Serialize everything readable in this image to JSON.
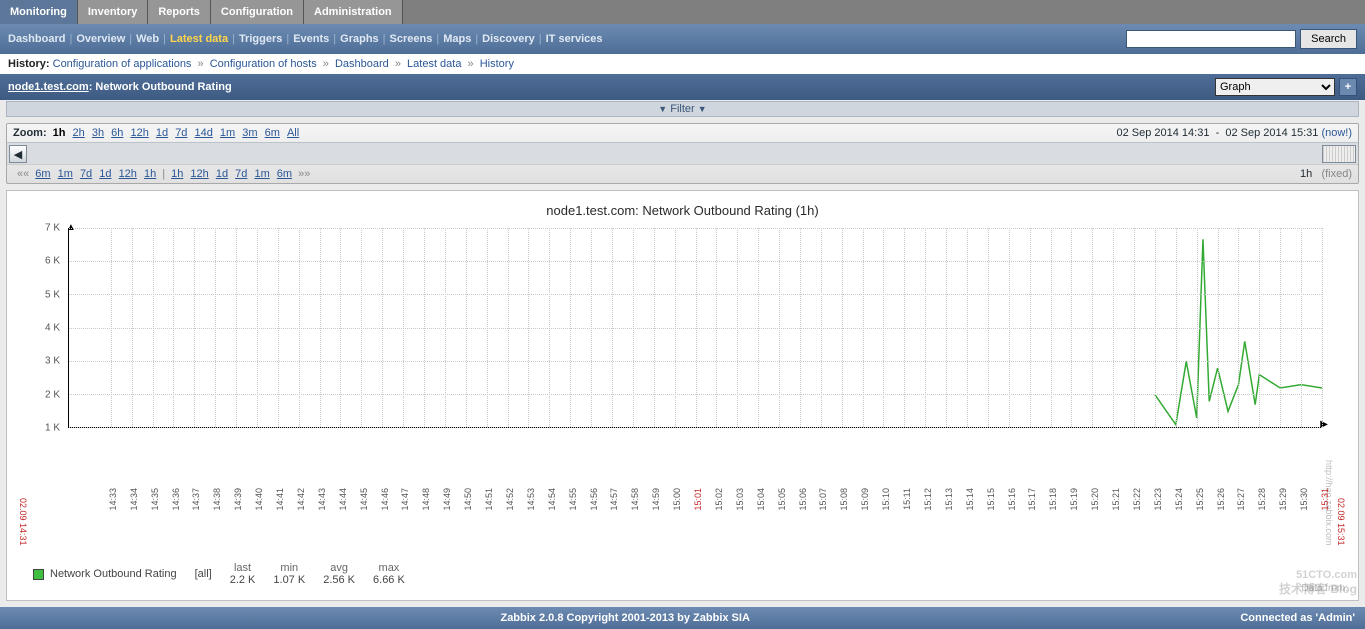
{
  "mainTabs": [
    "Monitoring",
    "Inventory",
    "Reports",
    "Configuration",
    "Administration"
  ],
  "mainTabActive": 0,
  "subTabs": [
    "Dashboard",
    "Overview",
    "Web",
    "Latest data",
    "Triggers",
    "Events",
    "Graphs",
    "Screens",
    "Maps",
    "Discovery",
    "IT services"
  ],
  "subTabActive": 3,
  "searchButton": "Search",
  "history": {
    "label": "History:",
    "crumbs": [
      "Configuration of applications",
      "Configuration of hosts",
      "Dashboard",
      "Latest data",
      "History"
    ]
  },
  "header": {
    "host": "node1.test.com",
    "sep": ": ",
    "item": "Network Outbound Rating",
    "selectOptions": [
      "Graph"
    ],
    "selectValue": "Graph"
  },
  "filterLabel": "Filter",
  "zoom": {
    "label": "Zoom:",
    "options": [
      "1h",
      "2h",
      "3h",
      "6h",
      "12h",
      "1d",
      "7d",
      "14d",
      "1m",
      "3m",
      "6m",
      "All"
    ],
    "current": "1h",
    "from": "02 Sep 2014 14:31",
    "dash": "-",
    "to": "02 Sep 2014 15:31",
    "now": "(now!)",
    "navLeft1": "««",
    "navLeft2": [
      "6m",
      "1m",
      "7d",
      "1d",
      "12h",
      "1h"
    ],
    "navMid": "|",
    "navRight": [
      "1h",
      "12h",
      "1d",
      "7d",
      "1m",
      "6m"
    ],
    "navEnd": "»»",
    "dur": "1h",
    "fixed": "(fixed)"
  },
  "chart_data": {
    "type": "line",
    "title": "node1.test.com: Network Outbound Rating (1h)",
    "xlabel": "",
    "ylabel": "",
    "ylim": [
      1000,
      7000
    ],
    "yticks": [
      "1 K",
      "2 K",
      "3 K",
      "4 K",
      "5 K",
      "6 K",
      "7 K"
    ],
    "x_ticks": [
      "14:33",
      "14:34",
      "14:35",
      "14:36",
      "14:37",
      "14:38",
      "14:39",
      "14:40",
      "14:41",
      "14:42",
      "14:43",
      "14:44",
      "14:45",
      "14:46",
      "14:47",
      "14:48",
      "14:49",
      "14:50",
      "14:51",
      "14:52",
      "14:53",
      "14:54",
      "14:55",
      "14:56",
      "14:57",
      "14:58",
      "14:59",
      "15:00",
      "15:01",
      "15:02",
      "15:03",
      "15:04",
      "15:05",
      "15:06",
      "15:07",
      "15:08",
      "15:09",
      "15:10",
      "15:11",
      "15:12",
      "15:13",
      "15:14",
      "15:15",
      "15:16",
      "15:17",
      "15:18",
      "15:19",
      "15:20",
      "15:21",
      "15:22",
      "15:23",
      "15:24",
      "15:25",
      "15:26",
      "15:27",
      "15:28",
      "15:29",
      "15:30",
      "15:31"
    ],
    "x_red_ticks": [
      "14:31",
      "15:01",
      "15:31"
    ],
    "x_bound_left": "02.09 14:31",
    "x_bound_right": "02.09 15:31",
    "right_watermark_url": "http://hao.zabbix.com",
    "series": [
      {
        "name": "Network Outbound Rating",
        "color": "#33aa33",
        "points": [
          {
            "t": "15:23",
            "v": 2000
          },
          {
            "t": "15:24",
            "v": 1100
          },
          {
            "t": "15:24.5",
            "v": 3000
          },
          {
            "t": "15:25",
            "v": 1300
          },
          {
            "t": "15:25.3",
            "v": 6660
          },
          {
            "t": "15:25.6",
            "v": 1800
          },
          {
            "t": "15:26",
            "v": 2800
          },
          {
            "t": "15:26.5",
            "v": 1500
          },
          {
            "t": "15:27",
            "v": 2300
          },
          {
            "t": "15:27.3",
            "v": 3600
          },
          {
            "t": "15:27.8",
            "v": 1700
          },
          {
            "t": "15:28",
            "v": 2600
          },
          {
            "t": "15:29",
            "v": 2200
          },
          {
            "t": "15:30",
            "v": 2300
          },
          {
            "t": "15:31",
            "v": 2200
          }
        ]
      }
    ],
    "legend": {
      "series_name": "Network Outbound Rating",
      "scope": "[all]",
      "cols": [
        "last",
        "min",
        "avg",
        "max"
      ],
      "vals": [
        "2.2 K",
        "1.07 K",
        "2.56 K",
        "6.66 K"
      ]
    },
    "data_from": "Data from:"
  },
  "watermark": {
    "big": "51CTO.com",
    "small": "技术博客  Blog"
  },
  "footer": {
    "copyright": "Zabbix 2.0.8 Copyright 2001-2013 by Zabbix SIA",
    "connected_as_label": "Connected as ",
    "user": "'Admin'"
  }
}
